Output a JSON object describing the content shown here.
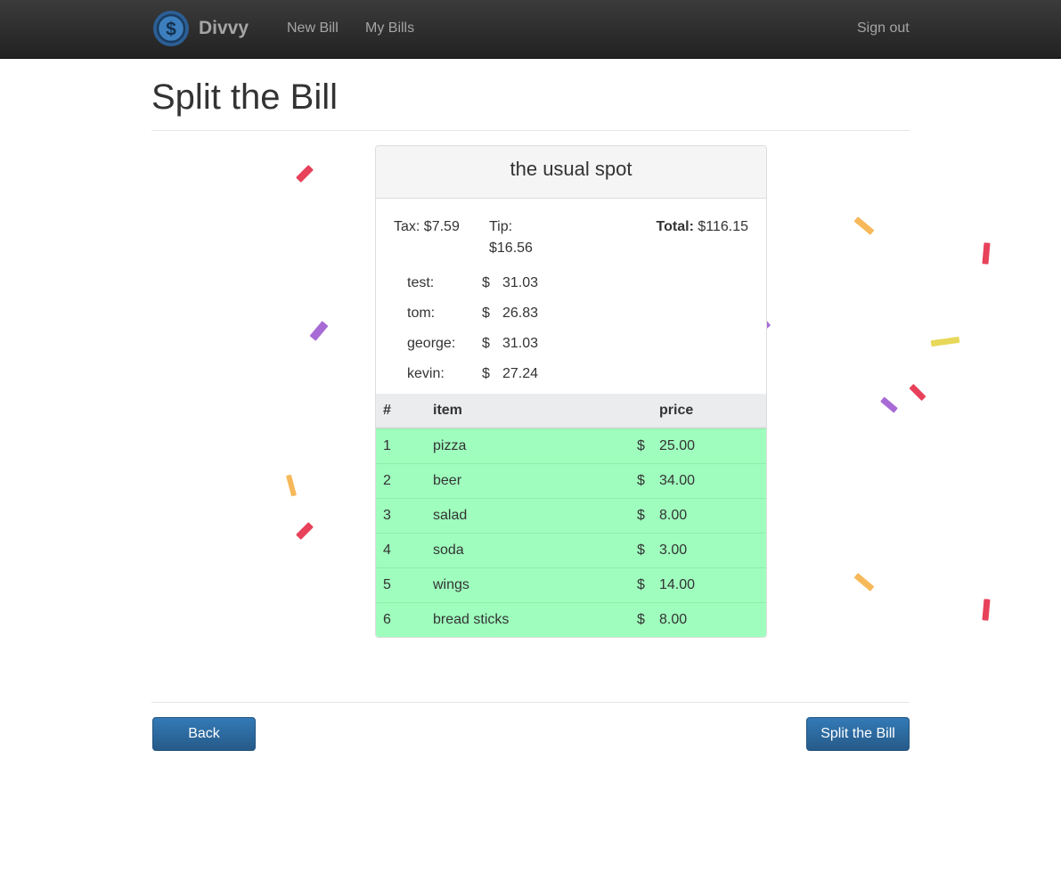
{
  "navbar": {
    "brand": "Divvy",
    "logo_symbol": "$",
    "links": {
      "new_bill": "New Bill",
      "my_bills": "My Bills",
      "sign_out": "Sign out"
    }
  },
  "page": {
    "title": "Split the Bill"
  },
  "bill": {
    "name": "the usual spot",
    "tax_label": "Tax:",
    "tax_value": "$7.59",
    "tip_label": "Tip:",
    "tip_value": "$16.56",
    "total_label": "Total:",
    "total_value": "$116.15",
    "people": [
      {
        "name": "test:",
        "currency": "$",
        "amount": "31.03"
      },
      {
        "name": "tom:",
        "currency": "$",
        "amount": "26.83"
      },
      {
        "name": "george:",
        "currency": "$",
        "amount": "31.03"
      },
      {
        "name": "kevin:",
        "currency": "$",
        "amount": "27.24"
      }
    ],
    "columns": {
      "num": "#",
      "item": "item",
      "price": "price"
    },
    "items": [
      {
        "num": "1",
        "name": "pizza",
        "currency": "$",
        "price": "25.00"
      },
      {
        "num": "2",
        "name": "beer",
        "currency": "$",
        "price": "34.00"
      },
      {
        "num": "3",
        "name": "salad",
        "currency": "$",
        "price": "8.00"
      },
      {
        "num": "4",
        "name": "soda",
        "currency": "$",
        "price": "3.00"
      },
      {
        "num": "5",
        "name": "wings",
        "currency": "$",
        "price": "14.00"
      },
      {
        "num": "6",
        "name": "bread sticks",
        "currency": "$",
        "price": "8.00"
      }
    ]
  },
  "actions": {
    "back": "Back",
    "split": "Split the Bill"
  },
  "colors": {
    "navbar": "#2b2b2b",
    "item_row": "#9ffdbe",
    "button": "#2d6ca2",
    "confetti": [
      "#e8415a",
      "#f7b85a",
      "#a86bd6",
      "#e8d85a"
    ]
  }
}
